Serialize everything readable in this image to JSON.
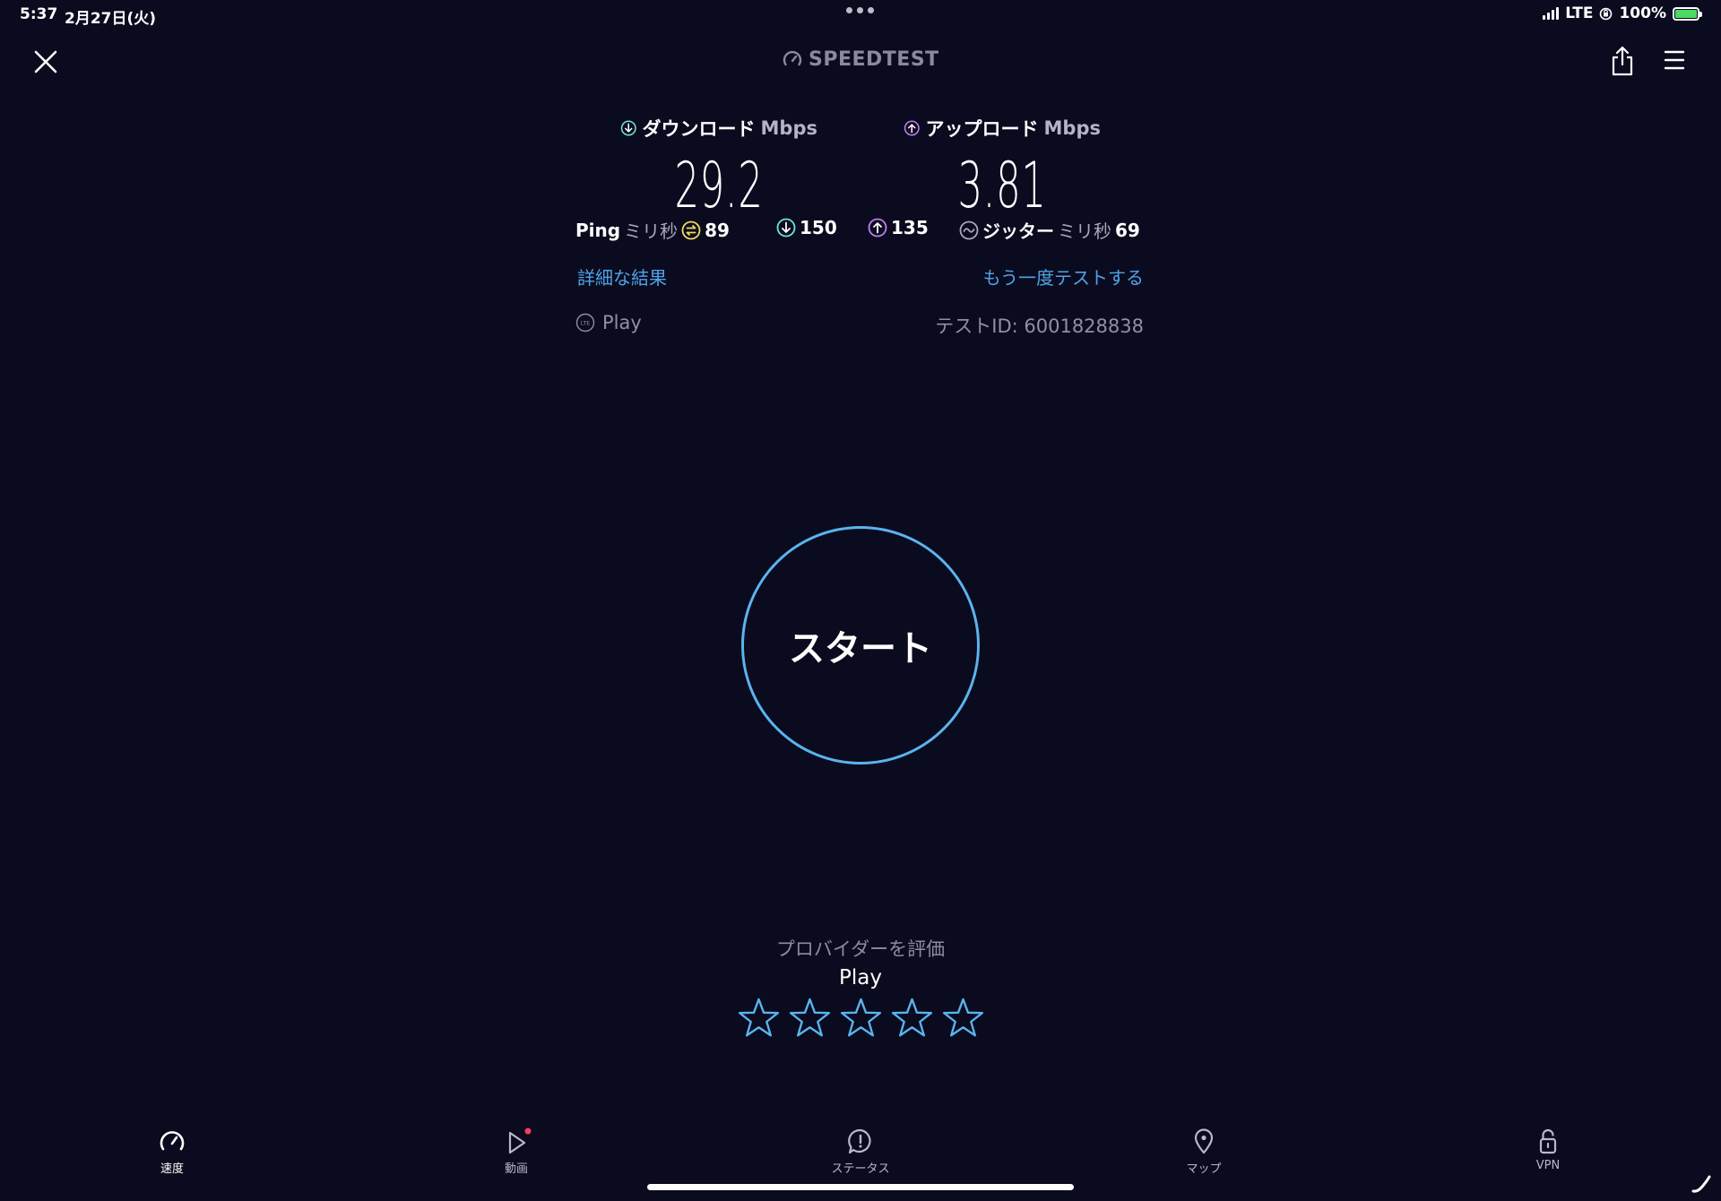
{
  "status_bar": {
    "time": "5:37",
    "date": "2月27日(火)",
    "network": "LTE",
    "battery": "100%"
  },
  "header": {
    "logo_text": "SPEEDTEST"
  },
  "results": {
    "download": {
      "label": "ダウンロード",
      "unit": "Mbps",
      "value": "29.2"
    },
    "upload": {
      "label": "アップロード",
      "unit": "Mbps",
      "value": "3.81"
    },
    "ping": {
      "label": "Ping",
      "unit": "ミリ秒",
      "idle": "89",
      "download": "150",
      "upload": "135"
    },
    "jitter": {
      "label": "ジッター",
      "unit": "ミリ秒",
      "value": "69"
    },
    "details_link": "詳細な結果",
    "retest_link": "もう一度テストする",
    "provider": "Play",
    "test_id": "テストID: 6001828838"
  },
  "start_button": "スタート",
  "rating": {
    "title": "プロバイダーを評価",
    "provider": "Play",
    "stars_filled": 0,
    "stars_total": 5
  },
  "tabs": [
    {
      "label": "速度",
      "icon": "speedometer-icon"
    },
    {
      "label": "動画",
      "icon": "play-icon"
    },
    {
      "label": "ステータス",
      "icon": "alert-bubble-icon"
    },
    {
      "label": "マップ",
      "icon": "map-pin-icon"
    },
    {
      "label": "VPN",
      "icon": "lock-icon"
    }
  ],
  "colors": {
    "background": "#0b0b1f",
    "accent_blue": "#5ab4ee",
    "link_blue": "#4fa3e8",
    "download_teal": "#6fe3d2",
    "upload_purple": "#c27cf0",
    "ping_yellow": "#f2dc5a",
    "notification_red": "#ff3b5c"
  }
}
